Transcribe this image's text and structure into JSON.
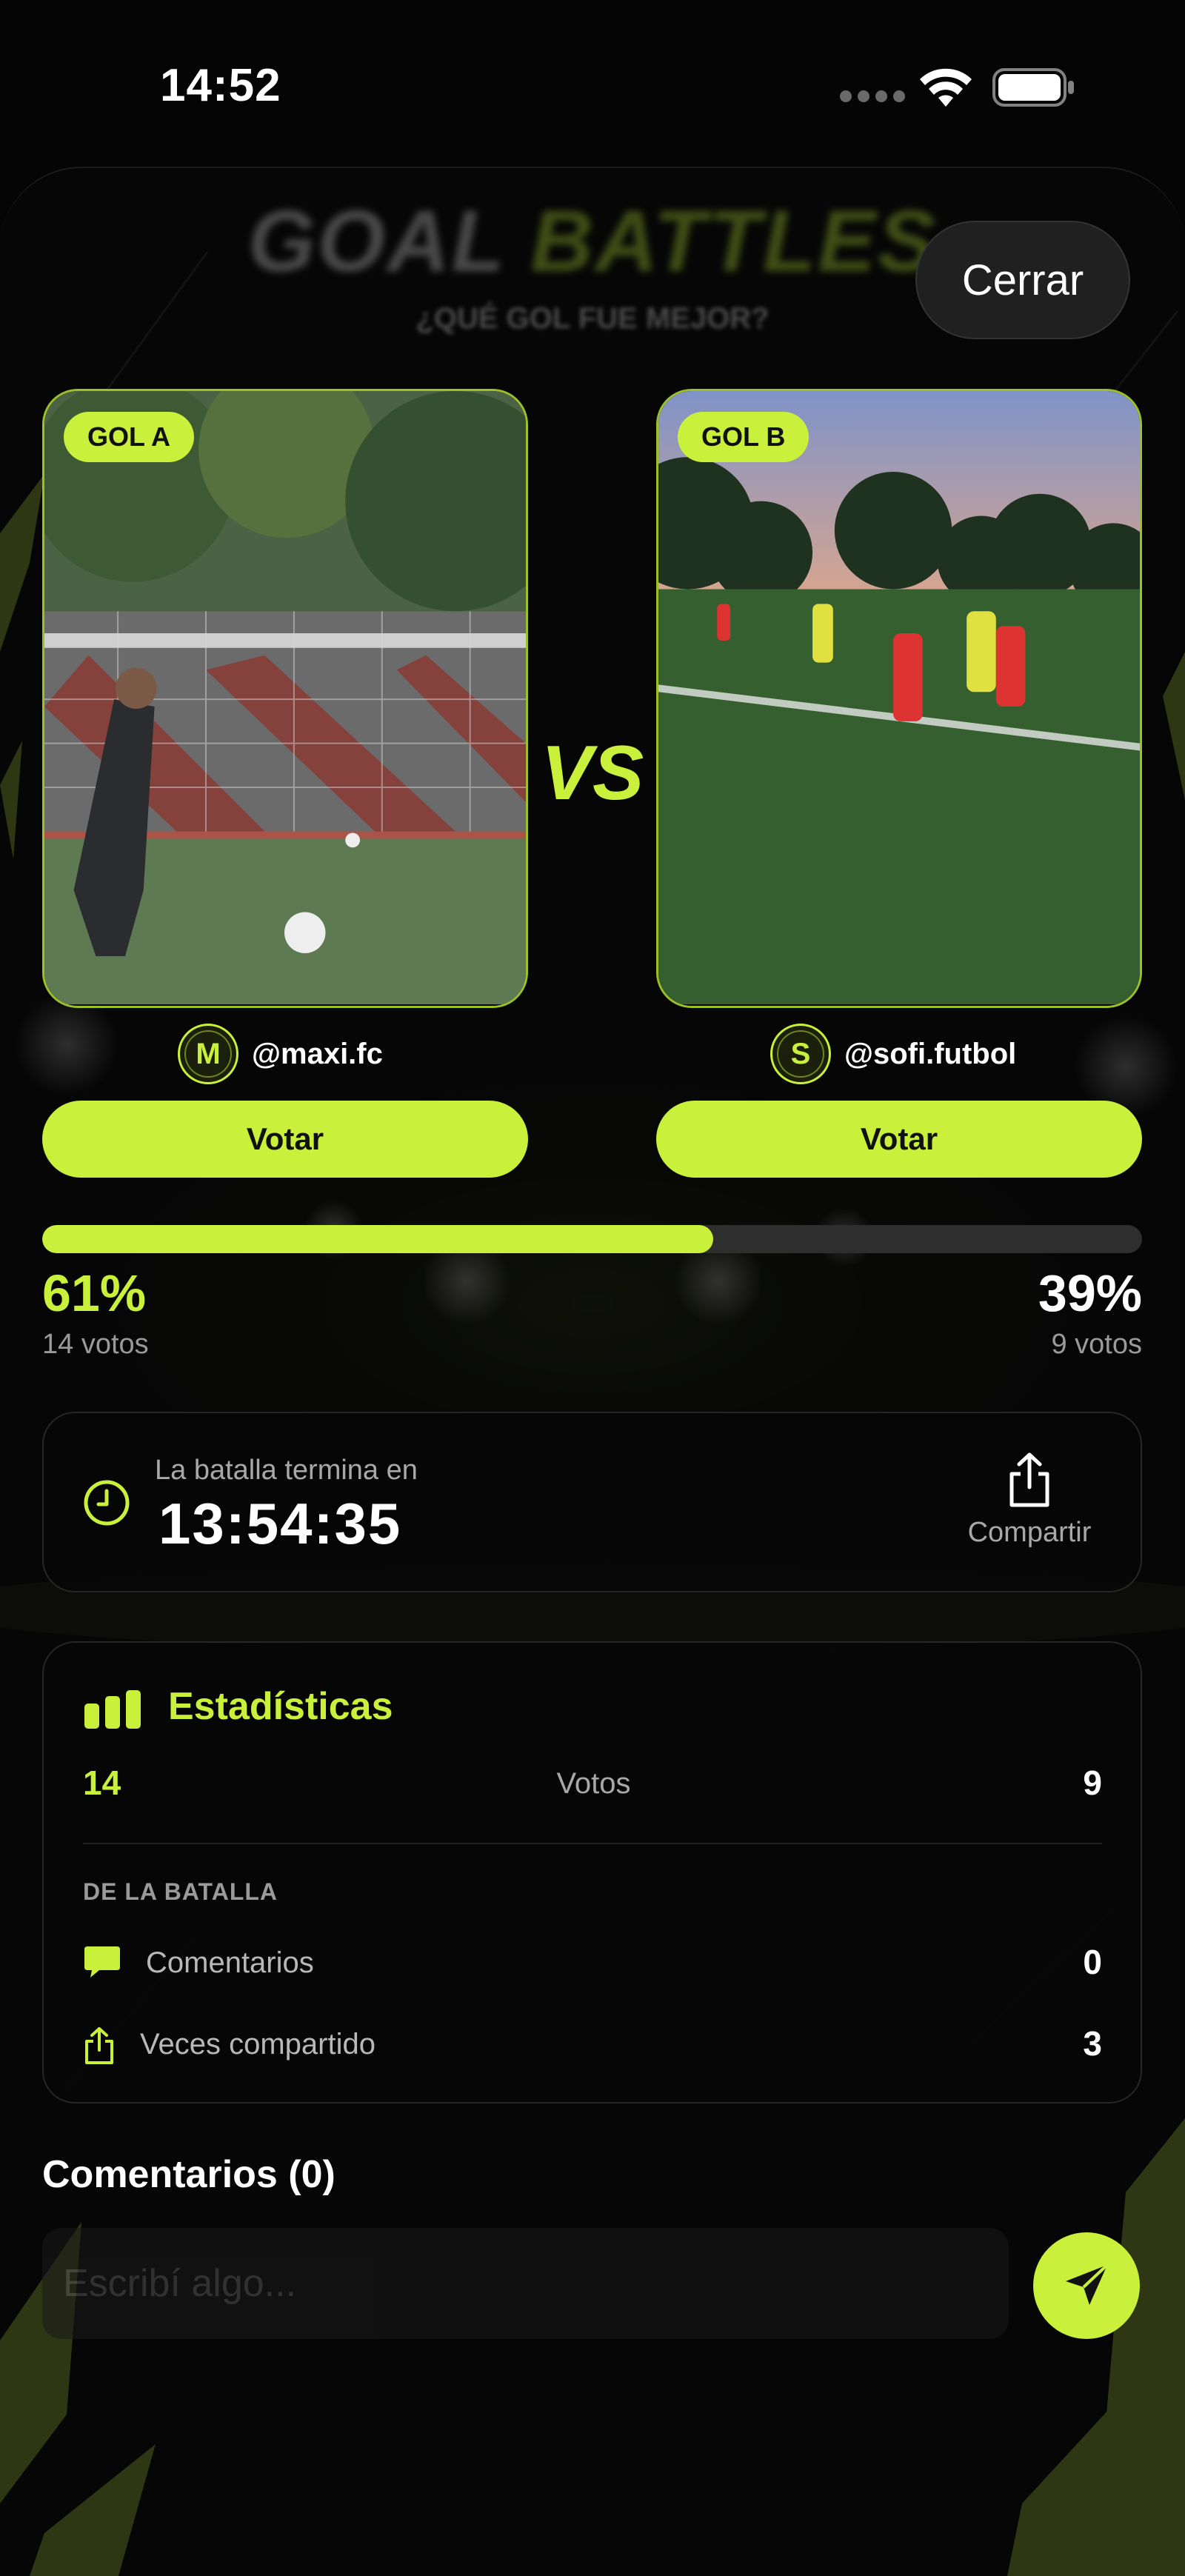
{
  "status_bar": {
    "time": "14:52"
  },
  "header": {
    "brand_word1": "GOAL",
    "brand_word2": "BATTLES",
    "brand_subtitle": "¿QUÉ GOL FUE MEJOR?",
    "close_label": "Cerrar"
  },
  "battle": {
    "vs_label": "VS",
    "goal_a": {
      "badge": "GOL A",
      "author_initial": "M",
      "author": "@maxi.fc",
      "vote_label": "Votar",
      "percent": "61%",
      "percent_value": 61,
      "votes_text": "14 votos"
    },
    "goal_b": {
      "badge": "GOL B",
      "author_initial": "S",
      "author": "@sofi.futbol",
      "vote_label": "Votar",
      "percent": "39%",
      "percent_value": 39,
      "votes_text": "9 votos"
    }
  },
  "timer": {
    "label": "La batalla termina en",
    "value": "13:54:35",
    "share_label": "Compartir"
  },
  "stats": {
    "title": "Estadísticas",
    "votes_a": "14",
    "votes_label": "Votos",
    "votes_b": "9",
    "section_label": "DE LA BATALLA",
    "rows": [
      {
        "label": "Comentarios",
        "value": "0",
        "icon": "comment-icon"
      },
      {
        "label": "Veces compartido",
        "value": "3",
        "icon": "share-icon"
      }
    ]
  },
  "comments": {
    "title": "Comentarios (0)",
    "placeholder": "Escribí algo..."
  },
  "colors": {
    "accent": "#c9f03a",
    "background": "#050505",
    "card": "#060606",
    "muted_text": "#a8a8a8"
  }
}
